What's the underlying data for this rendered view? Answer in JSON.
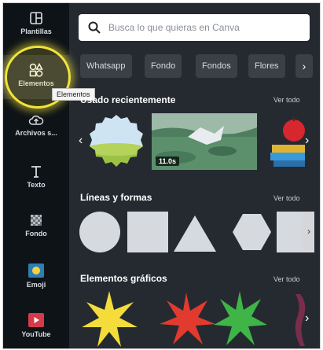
{
  "sidebar": {
    "items": [
      {
        "label": "Plantillas",
        "icon": "templates-icon"
      },
      {
        "label": "Elementos",
        "icon": "elements-icon"
      },
      {
        "label": "Archivos s...",
        "icon": "upload-cloud-icon"
      },
      {
        "label": "Texto",
        "icon": "text-icon"
      },
      {
        "label": "Fondo",
        "icon": "background-icon"
      },
      {
        "label": "Emoji",
        "icon": "emoji-icon"
      },
      {
        "label": "YouTube",
        "icon": "youtube-icon"
      }
    ],
    "tooltip": "Elementos"
  },
  "search": {
    "placeholder": "Busca lo que quieras en Canva"
  },
  "chips": [
    "Whatsapp",
    "Fondo",
    "Fondos",
    "Flores"
  ],
  "sections": {
    "recent": {
      "title": "Usado recientemente",
      "see_all": "Ver todo",
      "video_duration": "11.0s"
    },
    "lines": {
      "title": "Líneas y formas",
      "see_all": "Ver todo"
    },
    "graphics": {
      "title": "Elementos gráficos",
      "see_all": "Ver todo"
    }
  },
  "colors": {
    "star_yellow": "#f4dc3a",
    "star_red": "#e23a2e",
    "star_green": "#3fb548",
    "shape_fill": "#d6dadf"
  }
}
